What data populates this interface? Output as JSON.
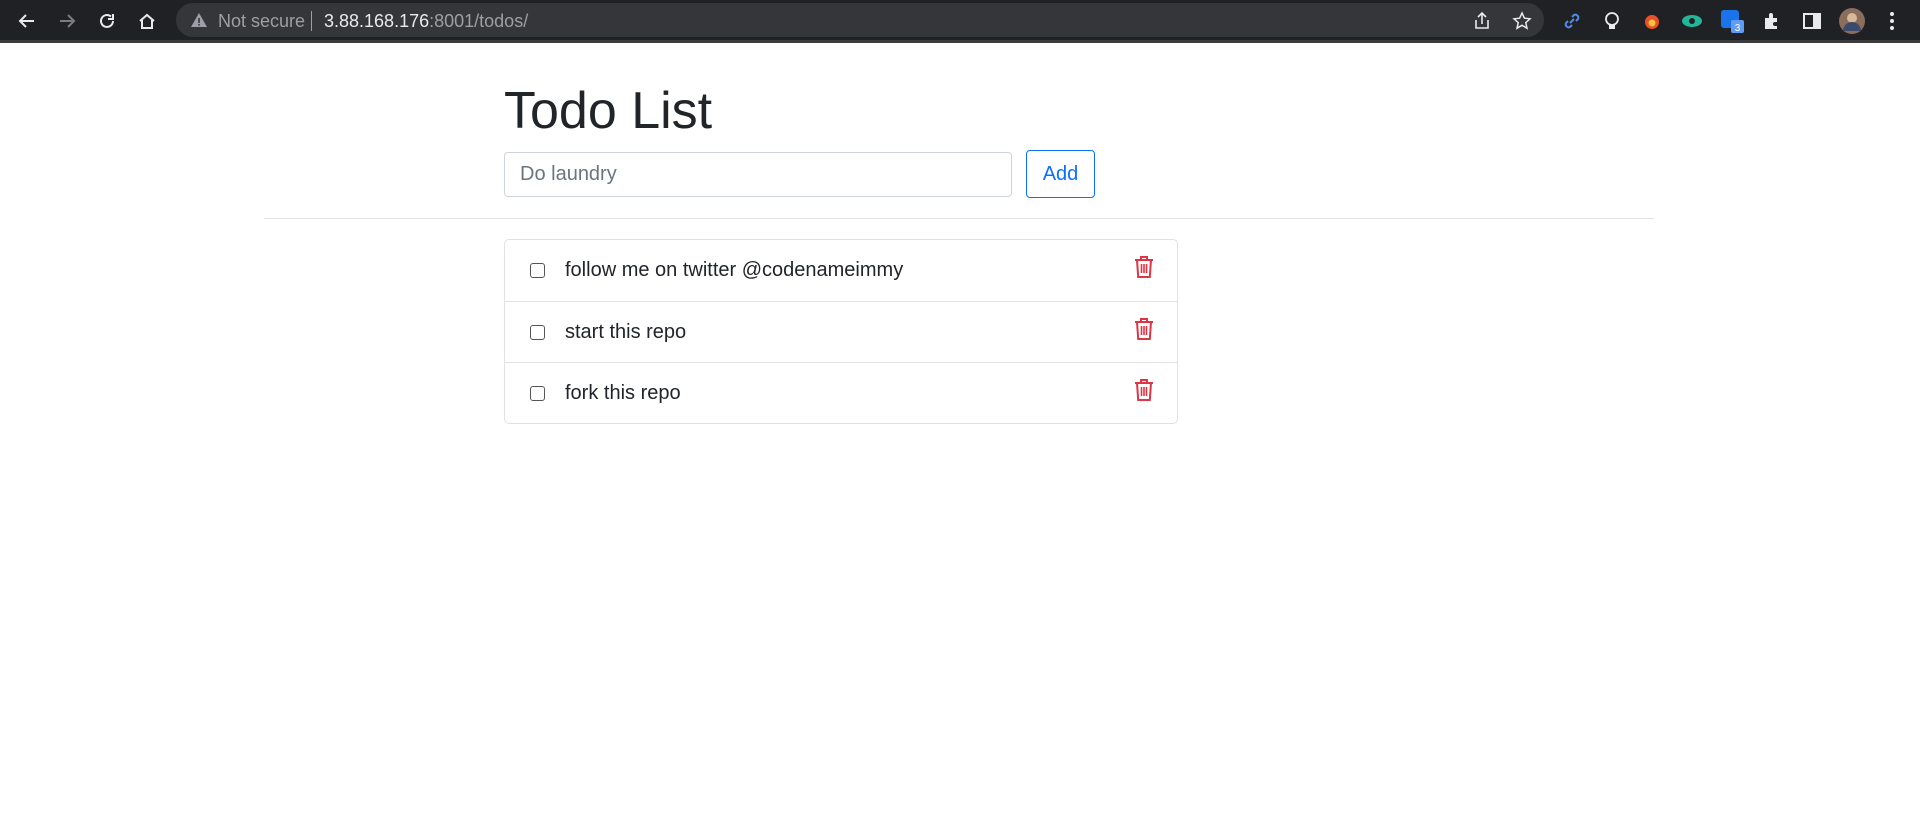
{
  "browser": {
    "security_label": "Not secure",
    "url_host": "3.88.168.176",
    "url_rest": ":8001/todos/",
    "extension_badge": "3"
  },
  "page": {
    "title": "Todo List",
    "input": {
      "placeholder": "Do laundry",
      "value": ""
    },
    "add_label": "Add",
    "todos": [
      {
        "label": "follow me on twitter @codenameimmy",
        "checked": false
      },
      {
        "label": "start this repo",
        "checked": false
      },
      {
        "label": "fork this repo",
        "checked": false
      }
    ]
  },
  "colors": {
    "delete": "#dc3545",
    "primary": "#0d6efd"
  }
}
